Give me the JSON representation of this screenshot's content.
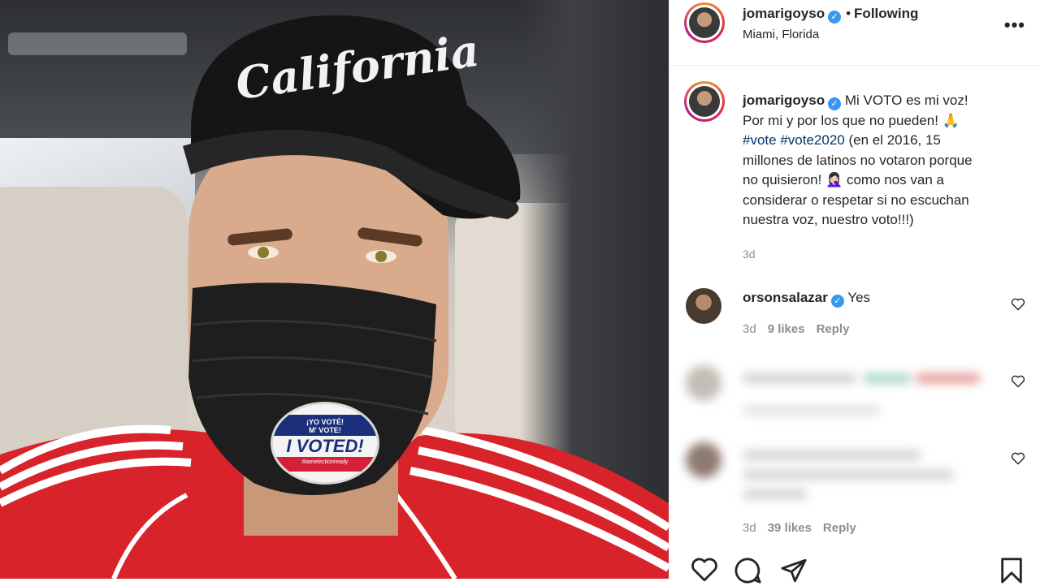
{
  "post": {
    "author": "jomarigoyso",
    "follow_separator": "•",
    "follow_status": "Following",
    "location": "Miami, Florida",
    "more_label": "•••",
    "verified_glyph": "✓"
  },
  "caption": {
    "author": "jomarigoyso",
    "line1": "Mi VOTO es mi voz!",
    "line2": "Por mi y por los que no pueden! 🙏",
    "hashtag1": "#vote",
    "hashtag2": "#vote2020",
    "line3_rest": " (en el 2016, 15",
    "line4": "millones de latinos no votaron porque",
    "line5": "no quisieron! 🤦🏻‍♀️ como nos van a",
    "line6": "considerar o respetar si no escuchan",
    "line7": "nuestra voz, nuestro voto!!!)",
    "time": "3d"
  },
  "comments": [
    {
      "author": "orsonsalazar",
      "text": "Yes",
      "time": "3d",
      "likes": "9 likes",
      "reply": "Reply"
    },
    {
      "author": "",
      "text": "",
      "time": "",
      "likes": "",
      "reply": ""
    },
    {
      "author": "",
      "text": "",
      "time": "3d",
      "likes": "39 likes",
      "reply": "Reply"
    }
  ],
  "sticker": {
    "top_line1": "¡YO VOTÉ!",
    "top_line2": "M' VOTE!",
    "main": "I VOTED!",
    "bottom": "#iamelectionready"
  },
  "cap_text": "California",
  "icons": {
    "like": "heart-icon",
    "comment": "comment-icon",
    "share": "send-icon",
    "save": "bookmark-icon"
  },
  "colors": {
    "link": "#00376b",
    "verified": "#3897f0",
    "jacket": "#d8232a"
  }
}
